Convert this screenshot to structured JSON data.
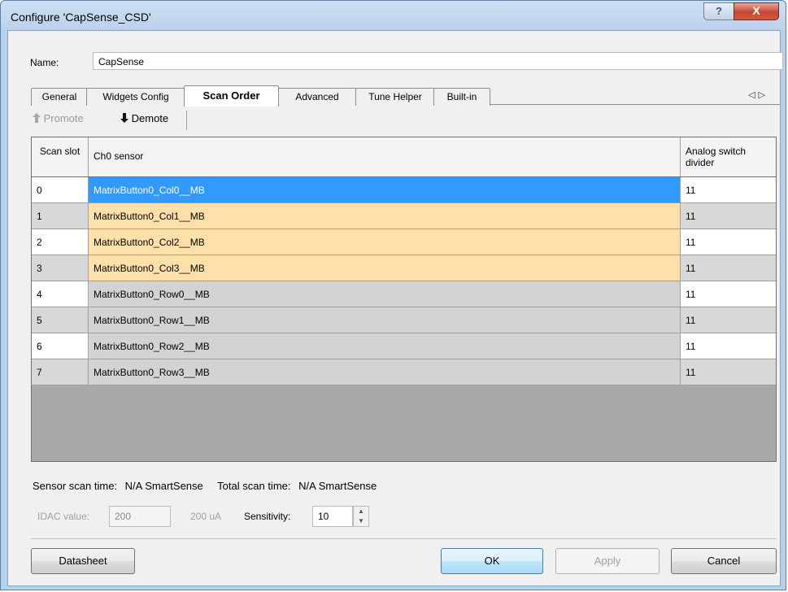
{
  "window": {
    "title": "Configure 'CapSense_CSD'",
    "help_glyph": "?",
    "close_glyph": "X"
  },
  "name_field": {
    "label": "Name:",
    "value": "CapSense"
  },
  "tabs": [
    {
      "label": "General",
      "active": false
    },
    {
      "label": "Widgets Config",
      "active": false
    },
    {
      "label": "Scan Order",
      "active": true
    },
    {
      "label": "Advanced",
      "active": false
    },
    {
      "label": "Tune Helper",
      "active": false
    },
    {
      "label": "Built-in",
      "active": false
    }
  ],
  "tab_nav": {
    "left": "◁",
    "right": "▷"
  },
  "toolbar": {
    "promote_icon": "up-arrow-icon",
    "promote_label": "Promote",
    "promote_enabled": false,
    "demote_icon": "down-arrow-icon",
    "demote_label": "Demote",
    "demote_enabled": true
  },
  "grid": {
    "columns": [
      "Scan slot",
      "Ch0 sensor",
      "Analog switch divider"
    ],
    "rows": [
      {
        "slot": "0",
        "sensor": "MatrixButton0_Col0__MB",
        "divider": "11",
        "style": "selected"
      },
      {
        "slot": "1",
        "sensor": "MatrixButton0_Col1__MB",
        "divider": "11",
        "style": "col"
      },
      {
        "slot": "2",
        "sensor": "MatrixButton0_Col2__MB",
        "divider": "11",
        "style": "col"
      },
      {
        "slot": "3",
        "sensor": "MatrixButton0_Col3__MB",
        "divider": "11",
        "style": "col"
      },
      {
        "slot": "4",
        "sensor": "MatrixButton0_Row0__MB",
        "divider": "11",
        "style": "row"
      },
      {
        "slot": "5",
        "sensor": "MatrixButton0_Row1__MB",
        "divider": "11",
        "style": "row"
      },
      {
        "slot": "6",
        "sensor": "MatrixButton0_Row2__MB",
        "divider": "11",
        "style": "row"
      },
      {
        "slot": "7",
        "sensor": "MatrixButton0_Row3__MB",
        "divider": "11",
        "style": "row"
      }
    ],
    "colors": {
      "selected": "#3399ff",
      "col": "#ffe0a8",
      "row": "#d3d3d3",
      "even_white": "#ffffff",
      "odd_gray": "#d8d8d8"
    }
  },
  "status": {
    "sensor_scan_label": "Sensor scan time:",
    "sensor_scan_value": "N/A SmartSense",
    "total_scan_label": "Total scan time:",
    "total_scan_value": "N/A SmartSense"
  },
  "idac": {
    "label": "IDAC value:",
    "value": "200",
    "unit_text": "200 uA",
    "sensitivity_label": "Sensitivity:",
    "sensitivity_value": "10"
  },
  "buttons": {
    "datasheet": "Datasheet",
    "ok": "OK",
    "apply": "Apply",
    "cancel": "Cancel"
  }
}
